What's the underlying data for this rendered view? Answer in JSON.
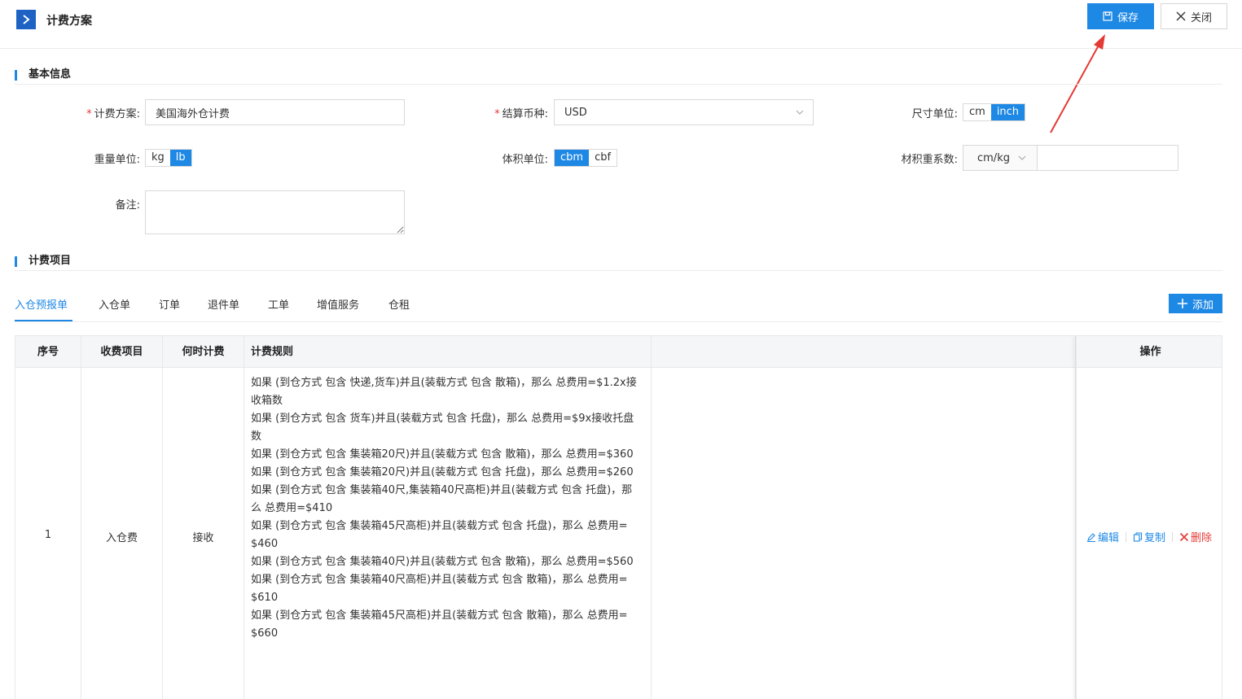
{
  "header": {
    "title": "计费方案",
    "save_label": "保存",
    "close_label": "关闭"
  },
  "basic_info": {
    "section_title": "基本信息",
    "plan_label": "计费方案:",
    "plan_value": "美国海外仓计费",
    "currency_label": "结算币种:",
    "currency_value": "USD",
    "size_unit_label": "尺寸单位:",
    "size_unit_options": [
      "cm",
      "inch"
    ],
    "size_unit_selected": "inch",
    "weight_unit_label": "重量单位:",
    "weight_unit_options": [
      "kg",
      "lb"
    ],
    "weight_unit_selected": "lb",
    "volume_unit_label": "体积单位:",
    "volume_unit_options": [
      "cbm",
      "cbf"
    ],
    "volume_unit_selected": "cbm",
    "volumetric_label": "材积重系数:",
    "volumetric_unit": "cm/kg",
    "volumetric_value": "",
    "remark_label": "备注:",
    "remark_value": ""
  },
  "billing_items": {
    "section_title": "计费项目",
    "tabs": [
      "入仓预报单",
      "入仓单",
      "订单",
      "退件单",
      "工单",
      "增值服务",
      "仓租"
    ],
    "active_tab": "入仓预报单",
    "add_label": "添加",
    "table": {
      "headers": [
        "序号",
        "收费项目",
        "何时计费",
        "计费规则",
        "",
        "操作"
      ],
      "rows": [
        {
          "index": "1",
          "item": "入仓费",
          "when": "接收",
          "rules": [
            "如果 (到仓方式 包含 快递,货车)并且(装载方式 包含 散箱)，那么 总费用=$1.2x接收箱数",
            "如果 (到仓方式 包含 货车)并且(装载方式 包含 托盘)，那么 总费用=$9x接收托盘数",
            "如果 (到仓方式 包含 集装箱20尺)并且(装载方式 包含 散箱)，那么 总费用=$360",
            "如果 (到仓方式 包含 集装箱20尺)并且(装载方式 包含 托盘)，那么 总费用=$260",
            "如果 (到仓方式 包含 集装箱40尺,集装箱40尺高柜)并且(装载方式 包含 托盘)，那么 总费用=$410",
            "如果 (到仓方式 包含 集装箱45尺高柜)并且(装载方式 包含 托盘)，那么 总费用=$460",
            "如果 (到仓方式 包含 集装箱40尺)并且(装载方式 包含 散箱)，那么 总费用=$560",
            "如果 (到仓方式 包含 集装箱40尺高柜)并且(装载方式 包含 散箱)，那么 总费用=$610",
            "如果 (到仓方式 包含 集装箱45尺高柜)并且(装载方式 包含 散箱)，那么 总费用=$660"
          ],
          "actions": [
            "编辑",
            "复制",
            "删除"
          ]
        }
      ]
    }
  },
  "colors": {
    "primary": "#1e88e5",
    "danger": "#e53935",
    "header_bg": "#f5f6f8"
  }
}
